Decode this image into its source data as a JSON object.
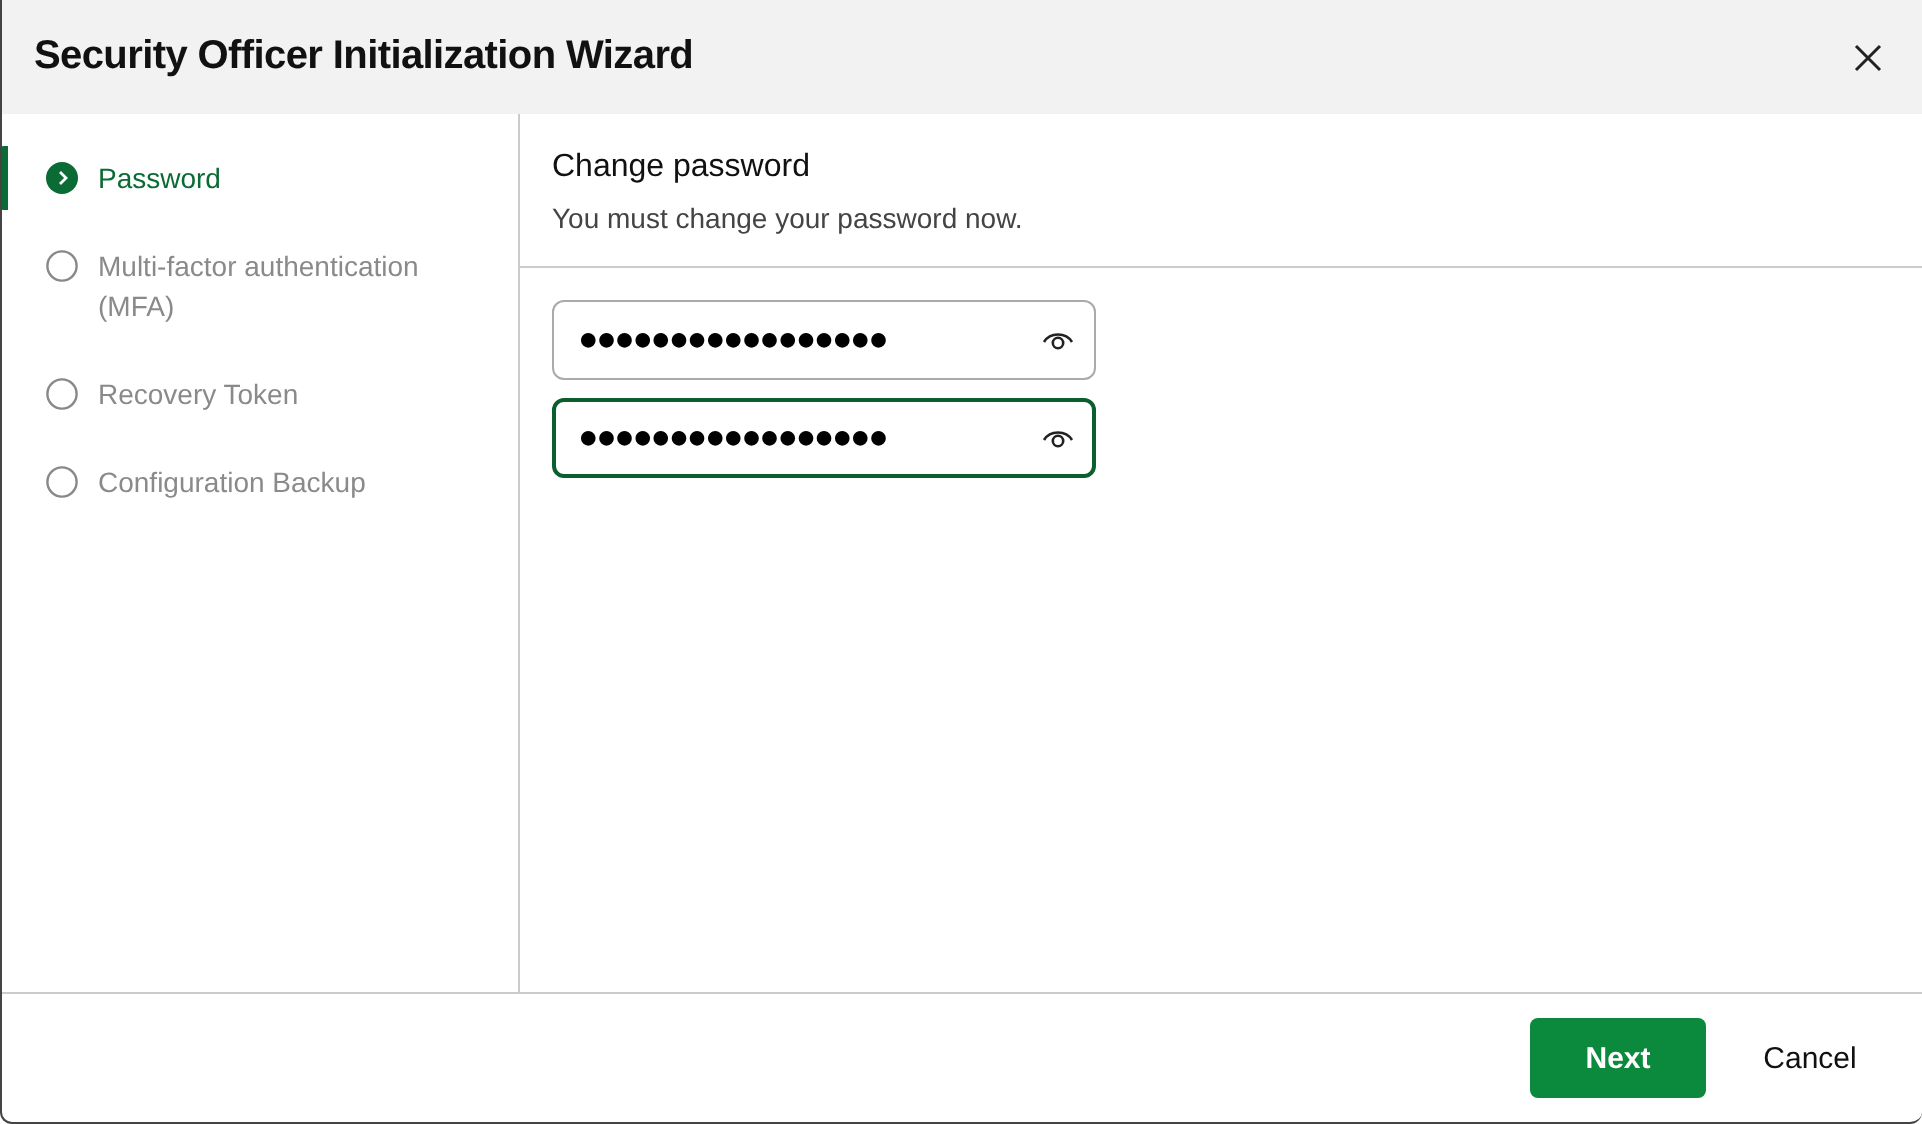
{
  "window": {
    "title": "Security Officer Initialization Wizard"
  },
  "steps": [
    {
      "label": "Password",
      "selected": true
    },
    {
      "label": "Multi-factor authentication (MFA)",
      "selected": false
    },
    {
      "label": "Recovery Token",
      "selected": false
    },
    {
      "label": "Configuration Backup",
      "selected": false
    }
  ],
  "page": {
    "heading": "Change password",
    "description": "You must change your password now."
  },
  "fields": [
    {
      "value": "●●●●●●●●●●●●●●●●●",
      "focused": false
    },
    {
      "value": "●●●●●●●●●●●●●●●●●",
      "focused": true
    }
  ],
  "buttons": [
    {
      "label": "Next",
      "kind": "primary"
    },
    {
      "label": "Cancel",
      "kind": "plain"
    }
  ]
}
